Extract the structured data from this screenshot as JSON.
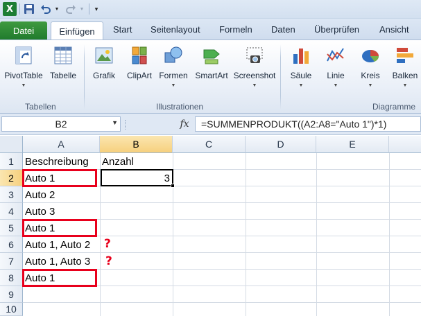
{
  "quick_access": {
    "app_icon": "excel-logo-icon",
    "app_letter": "X",
    "items": [
      "save-icon",
      "undo-icon",
      "redo-icon",
      "customize-qat-icon"
    ]
  },
  "tabs": {
    "file": "Datei",
    "items": [
      "Einfügen",
      "Start",
      "Seitenlayout",
      "Formeln",
      "Daten",
      "Überprüfen",
      "Ansicht"
    ],
    "active": "Einfügen"
  },
  "ribbon": {
    "groups": [
      {
        "label": "Tabellen",
        "buttons": [
          {
            "label": "PivotTable",
            "icon": "pivot-table-icon"
          },
          {
            "label": "Tabelle",
            "icon": "table-icon"
          }
        ]
      },
      {
        "label": "Illustrationen",
        "buttons": [
          {
            "label": "Grafik",
            "icon": "picture-icon"
          },
          {
            "label": "ClipArt",
            "icon": "clipart-icon"
          },
          {
            "label": "Formen",
            "icon": "shapes-icon"
          },
          {
            "label": "SmartArt",
            "icon": "smartart-icon"
          },
          {
            "label": "Screenshot",
            "icon": "screenshot-icon"
          }
        ]
      },
      {
        "label": "Diagramme",
        "buttons": [
          {
            "label": "Säule",
            "icon": "column-chart-icon"
          },
          {
            "label": "Linie",
            "icon": "line-chart-icon"
          },
          {
            "label": "Kreis",
            "icon": "pie-chart-icon"
          },
          {
            "label": "Balken",
            "icon": "bar-chart-icon"
          }
        ]
      }
    ]
  },
  "formula_bar": {
    "name_box": "B2",
    "fx_label": "fx",
    "formula": "=SUMMENPRODUKT((A2:A8=\"Auto 1\")*1)"
  },
  "sheet": {
    "columns": [
      "A",
      "B",
      "C",
      "D",
      "E"
    ],
    "rows": [
      "1",
      "2",
      "3",
      "4",
      "5",
      "6",
      "7",
      "8",
      "9",
      "10"
    ],
    "selected_column": "B",
    "selected_row": "2",
    "cells": {
      "A1": "Beschreibung",
      "B1": "Anzahl",
      "A2": "Auto 1",
      "B2": "3",
      "A3": "Auto 2",
      "A4": "Auto 3",
      "A5": "Auto 1",
      "A6": "Auto 1, Auto 2",
      "A7": "Auto 1, Auto 3",
      "A8": "Auto 1"
    },
    "highlighted_cells": [
      "A2",
      "A5",
      "A8"
    ],
    "question_marks": {
      "row6": "?",
      "row7": "?"
    },
    "highlight_color": "#e8001c"
  }
}
